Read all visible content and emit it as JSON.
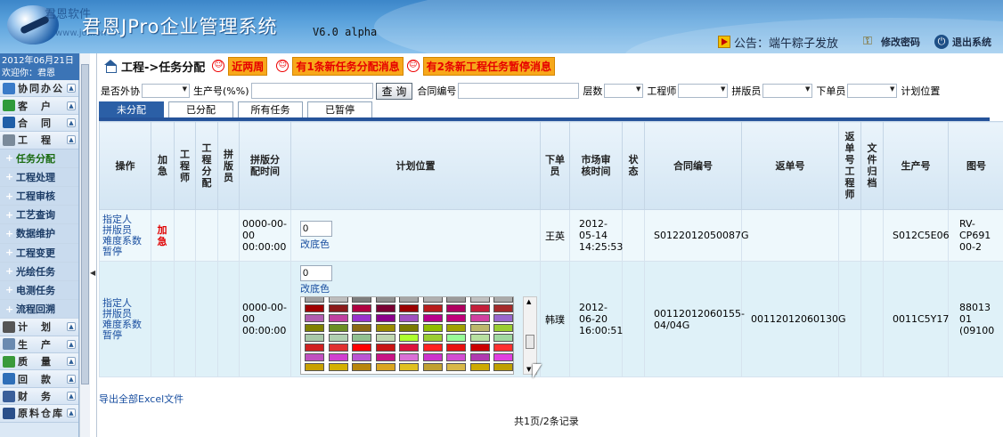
{
  "header": {
    "brand_small": "君恩软件",
    "brand_url": "www.jo...on",
    "title": "君恩JPro企业管理系统",
    "version": "V6.0 alpha",
    "notice": "公告：端午粽子发放",
    "change_password": "修改密码",
    "logout": "退出系统"
  },
  "sidebar": {
    "date": "2012年06月21日",
    "welcome": "欢迎你：君恩",
    "items_top": [
      {
        "label": "协同办公",
        "icon": "office-icon",
        "color": "#3a7bc8"
      },
      {
        "label": "客　户",
        "icon": "customer-icon",
        "color": "#2f9a3a"
      },
      {
        "label": "合　同",
        "icon": "contract-icon",
        "color": "#1f5fa8"
      },
      {
        "label": "工　程",
        "icon": "gear-icon",
        "color": "#7a8a9a"
      }
    ],
    "sub_items": [
      {
        "label": "任务分配",
        "active": true
      },
      {
        "label": "工程处理"
      },
      {
        "label": "工程审核"
      },
      {
        "label": "工艺查询"
      },
      {
        "label": "数据维护"
      },
      {
        "label": "工程变更"
      },
      {
        "label": "光绘任务"
      },
      {
        "label": "电测任务"
      },
      {
        "label": "流程回溯"
      }
    ],
    "items_bottom": [
      {
        "label": "计　划",
        "icon": "plan-icon",
        "color": "#555555"
      },
      {
        "label": "生　产",
        "icon": "production-icon",
        "color": "#6a8ab0"
      },
      {
        "label": "质　量",
        "icon": "quality-icon",
        "color": "#3a9a3a"
      },
      {
        "label": "回　款",
        "icon": "payment-icon",
        "color": "#2f6fb8"
      },
      {
        "label": "财　务",
        "icon": "finance-icon",
        "color": "#3a5f9a"
      },
      {
        "label": "原料仓库",
        "icon": "warehouse-icon",
        "color": "#2a4f8a"
      }
    ]
  },
  "breadcrumb": {
    "path": "工程->任务分配",
    "tags": [
      "近两周",
      "有1条新任务分配消息",
      "有2条新工程任务暂停消息"
    ]
  },
  "filters": {
    "outsource_label": "是否外协",
    "production_no_label": "生产号(%%)",
    "query_button": "查 询",
    "contract_no_label": "合同编号",
    "layers_label": "层数",
    "engineer_label": "工程师",
    "layout_label": "拼版员",
    "order_person_label": "下单员",
    "plan_position_label": "计划位置"
  },
  "tabs": [
    "未分配",
    "已分配",
    "所有任务",
    "已暂停"
  ],
  "table": {
    "columns": [
      "操作",
      "加急",
      "工程师",
      "工程分配",
      "拼版员",
      "拼版分配时间",
      "计划位置",
      "下单员",
      "市场审核时间",
      "状态",
      "合同编号",
      "返单号",
      "返单号工程师",
      "文件归档",
      "生产号",
      "图号"
    ],
    "rows": [
      {
        "actions": [
          "指定人",
          "拼版员",
          "难度系数",
          "暂停"
        ],
        "urgent": "加急",
        "layout_time": "0000-00-00 00:00:00",
        "plan_position": "0",
        "change_color": "改底色",
        "order_person": "王英",
        "review_time": "2012-05-14 14:25:53",
        "contract_no": "S0122012050087G",
        "return_no": "",
        "production_no": "S012C5E06",
        "drawing_no": "RV-CP691 00-2"
      },
      {
        "actions": [
          "指定人",
          "拼版员",
          "难度系数",
          "暂停"
        ],
        "urgent": "",
        "layout_time": "0000-00-00 00:00:00",
        "plan_position": "0",
        "change_color": "改底色",
        "order_person": "韩璞",
        "review_time": "2012-06-20 16:00:51",
        "contract_no": "00112012060155-04/04G",
        "return_no": "00112012060130G",
        "production_no": "0011C5Y17",
        "drawing_no": "88013 01 (09100"
      }
    ]
  },
  "palette_colors": [
    [
      "#9e9e9e",
      "#bdbdbd",
      "#7d7d7d",
      "#8f8f8f",
      "#a6a6a6",
      "#b0b0b0",
      "#9a9a9a",
      "#c0c0c0",
      "#aaaaaa",
      "#b8e8ff"
    ],
    [
      "#a00000",
      "#8b1a1a",
      "#b00040",
      "#7a0033",
      "#9b0000",
      "#b81c1c",
      "#b00060",
      "#c41e3a",
      "#a52a2a",
      "#b8860b"
    ],
    [
      "#b05cb0",
      "#c040a0",
      "#9932cc",
      "#8b008b",
      "#a050c0",
      "#b8008b",
      "#c0007a",
      "#d040a0",
      "#9966cc",
      "#b04080"
    ],
    [
      "#808000",
      "#6b8e23",
      "#8b6914",
      "#9a8a00",
      "#7a7a00",
      "#8fbc00",
      "#a0a000",
      "#bdb76b",
      "#9acd32",
      "#6b6b00"
    ],
    [
      "#a8c8a8",
      "#b0d0b0",
      "#90c090",
      "#c0d8b0",
      "#adff2f",
      "#9acd32",
      "#98fb98",
      "#b8e0a0",
      "#a0d8a0",
      "#c0e8c0"
    ],
    [
      "#d02020",
      "#e03030",
      "#ff0000",
      "#c81414",
      "#dc143c",
      "#ff2020",
      "#e81010",
      "#cc0000",
      "#ff3030",
      "#b22222"
    ],
    [
      "#c050c0",
      "#d040d0",
      "#ba55d3",
      "#c71585",
      "#da70d6",
      "#cc33cc",
      "#d24dd2",
      "#b03ab0",
      "#e040e0",
      "#c000c0"
    ],
    [
      "#c8a000",
      "#d4b000",
      "#b8860b",
      "#daa520",
      "#e0c020",
      "#c0a030",
      "#d8b848",
      "#cdaa00",
      "#bfa000",
      "#e6c000"
    ]
  ],
  "footer": {
    "export": "导出全部Excel文件",
    "pager": "共1页/2条记录"
  }
}
